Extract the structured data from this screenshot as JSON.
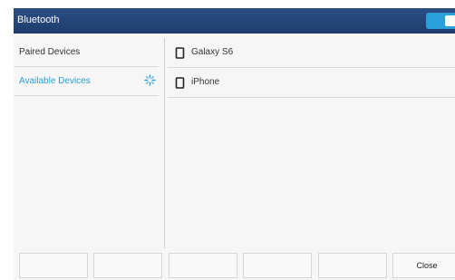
{
  "header": {
    "title": "Bluetooth",
    "toggle_state": "on"
  },
  "menu": {
    "items": [
      {
        "label": "Paired Devices",
        "active": false
      },
      {
        "label": "Available Devices",
        "active": true,
        "icon": "scanning-icon"
      }
    ]
  },
  "devices": [
    {
      "name": "Galaxy S6",
      "icon": "phone-icon"
    },
    {
      "name": "iPhone",
      "icon": "phone-icon"
    }
  ],
  "softkeys": [
    "",
    "",
    "",
    "",
    "",
    "Close"
  ],
  "colors": {
    "header": "#1f3c6c",
    "accent": "#2a9fd8",
    "background": "#f6f6f6"
  }
}
